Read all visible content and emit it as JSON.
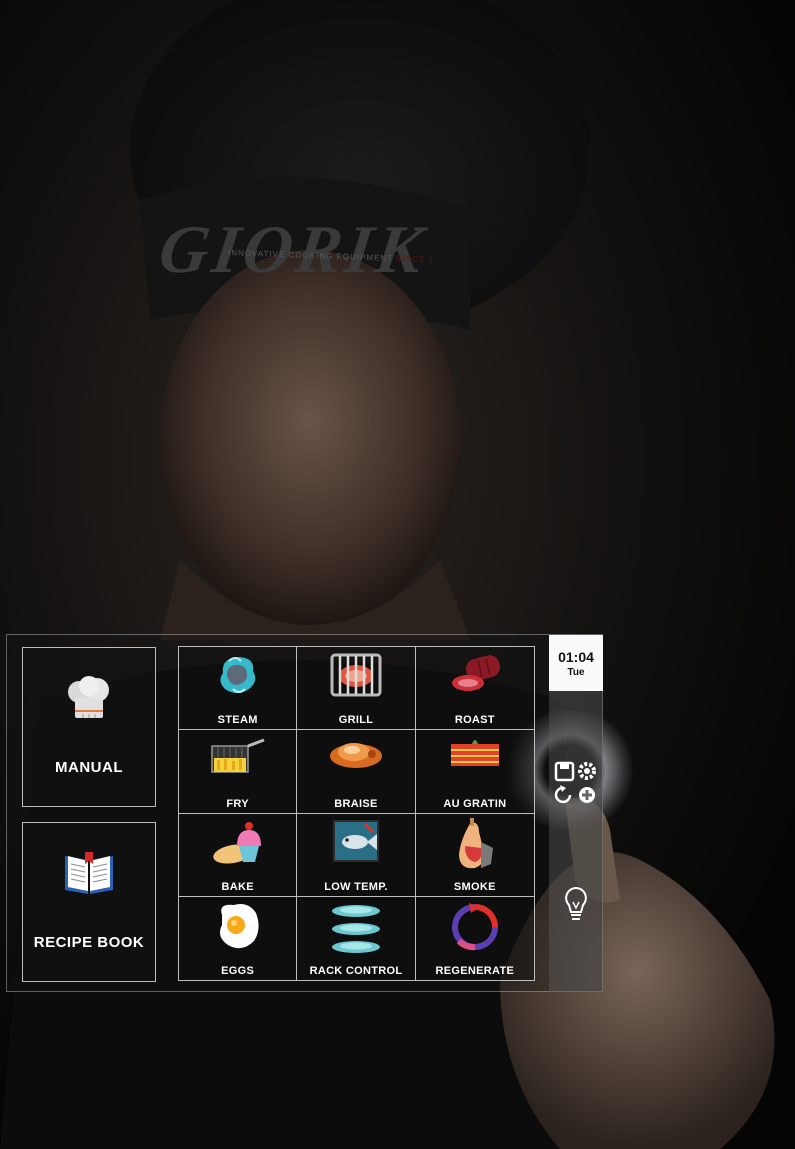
{
  "brand": {
    "name": "GIORIK",
    "tagline": "INNOVATIVE COOKING EQUIPMENT",
    "since": "SINCE 1"
  },
  "sidebar": {
    "manual": {
      "label": "MANUAL",
      "icon": "chef-hat-icon"
    },
    "recipe_book": {
      "label": "RECIPE BOOK",
      "icon": "open-book-icon"
    }
  },
  "modes": [
    {
      "label": "STEAM",
      "icon": "steam-icon"
    },
    {
      "label": "GRILL",
      "icon": "grill-icon"
    },
    {
      "label": "ROAST",
      "icon": "roast-icon"
    },
    {
      "label": "FRY",
      "icon": "fry-basket-icon"
    },
    {
      "label": "BRAISE",
      "icon": "braise-icon"
    },
    {
      "label": "AU GRATIN",
      "icon": "au-gratin-icon"
    },
    {
      "label": "BAKE",
      "icon": "bake-icon"
    },
    {
      "label": "LOW TEMP.",
      "icon": "fish-icon"
    },
    {
      "label": "SMOKE",
      "icon": "smoke-ham-icon"
    },
    {
      "label": "EGGS",
      "icon": "egg-icon"
    },
    {
      "label": "RACK CONTROL",
      "icon": "rack-icon"
    },
    {
      "label": "REGENERATE",
      "icon": "regenerate-icon"
    }
  ],
  "status": {
    "time": "01:04",
    "day": "Tue"
  },
  "rail": {
    "icons": [
      "save-icon",
      "settings-icon",
      "reset-icon",
      "add-icon",
      "lightbulb-icon"
    ]
  },
  "colors": {
    "panel_border": "#bdbdbd",
    "clock_bg": "#fafafa",
    "text": "#ffffff"
  }
}
